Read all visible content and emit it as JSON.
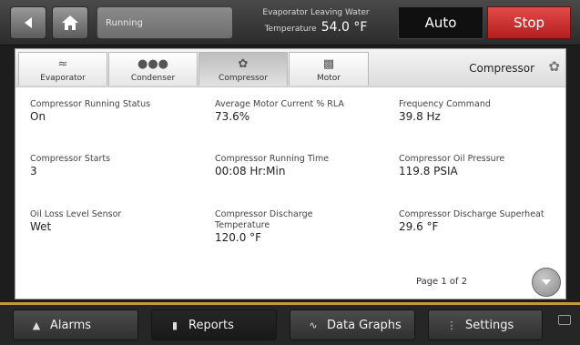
{
  "header": {
    "status": "Running",
    "leaving_water_label_1": "Evaporator Leaving Water",
    "leaving_water_label_2": "Temperature",
    "leaving_water_value": "54.0 °F",
    "auto_label": "Auto",
    "stop_label": "Stop"
  },
  "tabs": [
    {
      "label": "Evaporator",
      "icon": "evaporator-icon"
    },
    {
      "label": "Condenser",
      "icon": "condenser-icon"
    },
    {
      "label": "Compressor",
      "icon": "compressor-icon"
    },
    {
      "label": "Motor",
      "icon": "motor-icon"
    }
  ],
  "section_title": "Compressor",
  "readings": [
    {
      "label": "Compressor Running Status",
      "value": "On"
    },
    {
      "label": "Average Motor Current % RLA",
      "value": "73.6%"
    },
    {
      "label": "Frequency Command",
      "value": "39.8 Hz"
    },
    {
      "label": "Compressor Starts",
      "value": "3"
    },
    {
      "label": "Compressor Running Time",
      "value": "00:08 Hr:Min"
    },
    {
      "label": "Compressor Oil Pressure",
      "value": "119.8 PSIA"
    },
    {
      "label": "Oil Loss Level Sensor",
      "value": "Wet"
    },
    {
      "label": "Compressor Discharge Temperature",
      "value": "120.0 °F"
    },
    {
      "label": "Compressor Discharge Superheat",
      "value": "29.6 °F"
    }
  ],
  "pagination": {
    "label": "Page 1 of 2"
  },
  "nav": [
    {
      "label": "Alarms",
      "icon": "bell-icon"
    },
    {
      "label": "Reports",
      "icon": "report-icon"
    },
    {
      "label": "Data Graphs",
      "icon": "graph-icon"
    },
    {
      "label": "Settings",
      "icon": "settings-icon"
    }
  ],
  "colors": {
    "stop": "#c62828",
    "divider": "#c39a3a",
    "background": "#1d1d1d"
  }
}
